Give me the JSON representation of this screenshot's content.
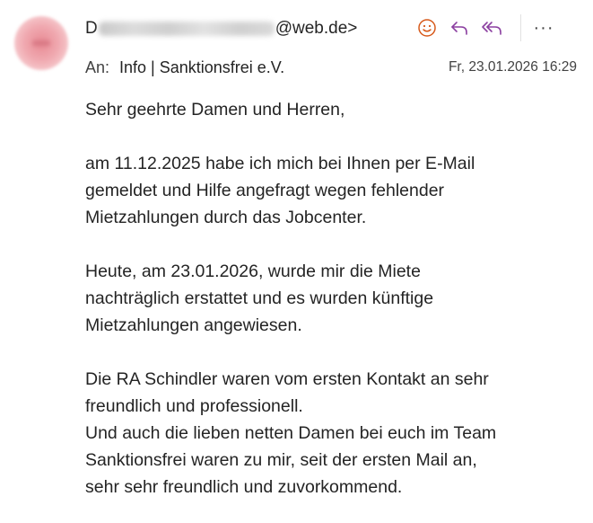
{
  "header": {
    "sender_visible_prefix": "D",
    "sender_visible_suffix": "@web.de>",
    "to_label": "An:",
    "to_value": "Info | Sanktionsfrei e.V.",
    "date": "Fr, 23.01.2026 16:29"
  },
  "actions": {
    "react_icon": "smiley-icon",
    "reply_icon": "reply-icon",
    "reply_all_icon": "reply-all-icon",
    "more_label": "···"
  },
  "colors": {
    "react": "#d75a1b",
    "reply": "#8b3fa0",
    "text": "#242424"
  },
  "message": {
    "greeting": "Sehr geehrte Damen und Herren,",
    "p1": [
      "am 11.12.2025 habe ich mich bei Ihnen per E-Mail",
      "gemeldet und Hilfe angefragt wegen fehlender",
      "Mietzahlungen durch das Jobcenter."
    ],
    "p2": [
      "Heute, am 23.01.2026, wurde mir die Miete",
      "nachträglich erstattet und es wurden künftige",
      "Mietzahlungen angewiesen."
    ],
    "p3": [
      "Die RA Schindler waren vom ersten Kontakt an sehr",
      "freundlich und professionell.",
      "Und auch die lieben netten Damen bei euch im Team",
      "Sanktionsfrei waren zu mir, seit der ersten Mail an,",
      "sehr sehr freundlich und zuvorkommend."
    ]
  }
}
